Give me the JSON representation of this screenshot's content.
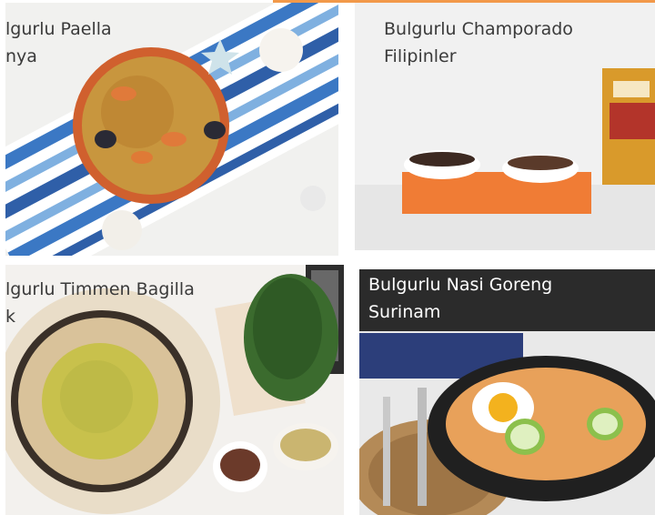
{
  "colors": {
    "accent": "#f2994a",
    "dark_caption_bg": "#2b2b2b"
  },
  "cards": [
    {
      "title_line1": "lgurlu Paella",
      "title_line2": "nya"
    },
    {
      "title_line1": "Bulgurlu Champorado",
      "title_line2": "Filipinler"
    },
    {
      "title_line1": "lgurlu Timmen Bagilla",
      "title_line2": "k"
    },
    {
      "title_line1": "Bulgurlu Nasi Goreng",
      "title_line2": "Surinam"
    }
  ]
}
